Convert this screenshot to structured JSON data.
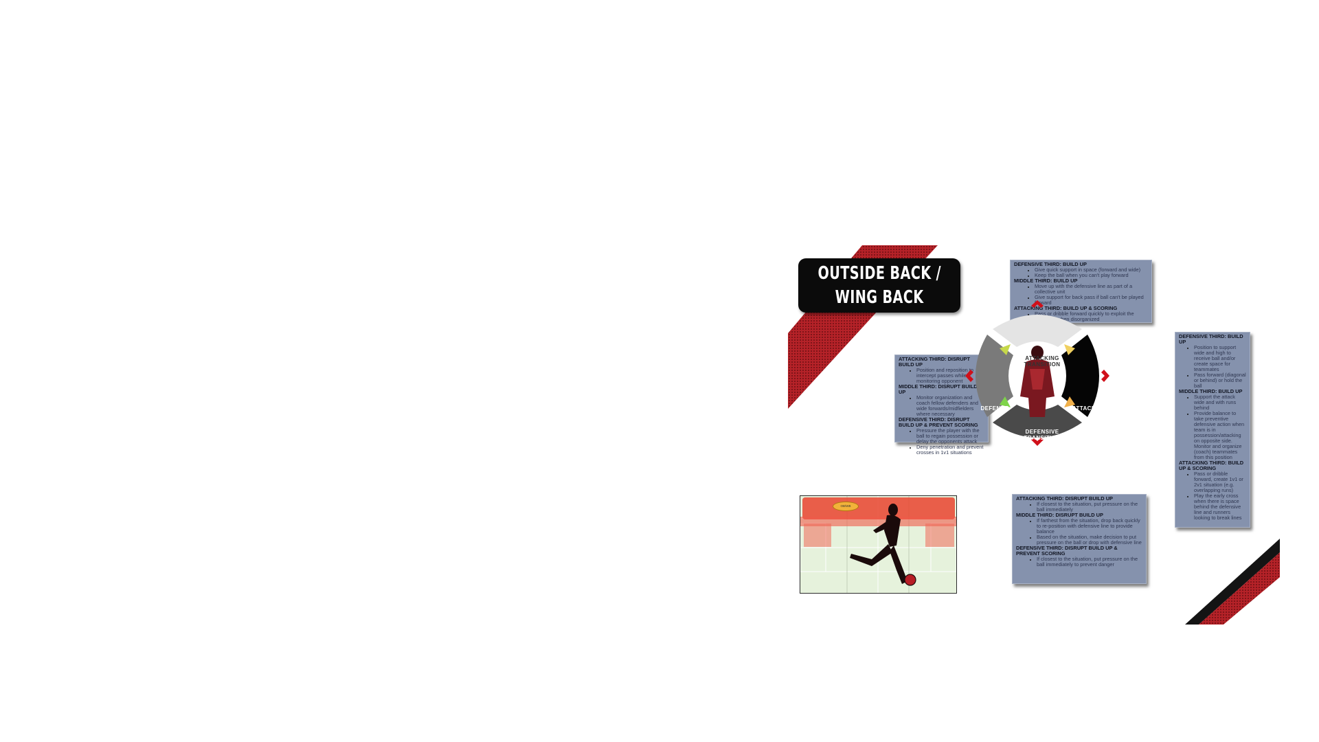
{
  "title": {
    "line1": "OUTSIDE BACK /",
    "line2": "WING BACK"
  },
  "colors": {
    "stripe_red": "#b8262b",
    "panel_bg": "#8592ad",
    "title_bg": "#0b0b0b",
    "arrow_red": "#d0101a"
  },
  "cycle": {
    "attacking_transition": {
      "line1": "ATTACKING",
      "line2": "TRANSITION"
    },
    "attack": "ATTACK",
    "defensive_transition": {
      "line1": "DEFENSIVE",
      "line2": "TRANSITION"
    },
    "defence": "DEFENCE"
  },
  "panels": {
    "top": [
      {
        "heading": "DEFENSIVE THIRD: BUILD UP",
        "items": [
          "Give quick support in space (forward and wide)",
          "Keep the ball when you can't play forward"
        ]
      },
      {
        "heading": "MIDDLE THIRD: BUILD UP",
        "items": [
          "Move up with the defensive line as part of a collective unit",
          "Give support for back pass if ball can't be played forward"
        ]
      },
      {
        "heading": "ATTACKING THIRD: BUILD UP & SCORING",
        "items": [
          "Pass or dribble forward quickly to exploit the opponent when disorganized"
        ]
      }
    ],
    "left": [
      {
        "heading": "ATTACKING THIRD: DISRUPT BUILD UP",
        "items": [
          "Position and reposition to intercept passes while monitoring opponent"
        ]
      },
      {
        "heading": "MIDDLE THIRD: DISRUPT BUILD UP",
        "items": [
          "Monitor organization and coach fellow defenders and wide forwards/midfielders where necessary"
        ]
      },
      {
        "heading": "DEFENSIVE THIRD: DISRUPT BUILD UP & PREVENT SCORING",
        "items": [
          "Pressure the player with the ball to regain possession or delay the opponents attack",
          "Deny penetration and prevent crosses in 1v1 situations"
        ]
      }
    ],
    "right": [
      {
        "heading": "DEFENSIVE THIRD: BUILD UP",
        "items": [
          "Position to support wide and high to receive ball and/or create space for teammates",
          "Pass forward (diagonal or behind) or hold the ball"
        ]
      },
      {
        "heading": "MIDDLE THIRD: BUILD UP",
        "items": [
          "Support the attack wide and with runs behind",
          "Provide balance to take preventive defensive action when team is in possession/attacking on opposite side. Monitor and organize (coach) teammates from this position"
        ]
      },
      {
        "heading": "ATTACKING THIRD: BUILD UP & SCORING",
        "items": [
          "Pass or dribble forward, create 1v1 or 2v1 situation (e.g. overlapping runs)",
          "Play the early cross when there is space behind the defensive line and runners looking to break lines"
        ]
      }
    ],
    "bottom": [
      {
        "heading": "ATTACKING THIRD: DISRUPT BUILD UP",
        "items": [
          "If closest to the situation, put pressure on the ball immediately"
        ]
      },
      {
        "heading": "MIDDLE THIRD: DISRUPT BUILD UP",
        "items": [
          "If farthest from the situation, drop back quickly to re-position with defensive line to provide balance",
          "Based on the situation, make decision to put pressure on the ball or drop with defensive line"
        ]
      },
      {
        "heading": "DEFENSIVE THIRD: DISRUPT BUILD UP & PREVENT SCORING",
        "items": [
          "If closest to the situation, put pressure on the ball immediately to prevent danger"
        ]
      }
    ]
  },
  "field": {
    "label": "OB/WB"
  }
}
